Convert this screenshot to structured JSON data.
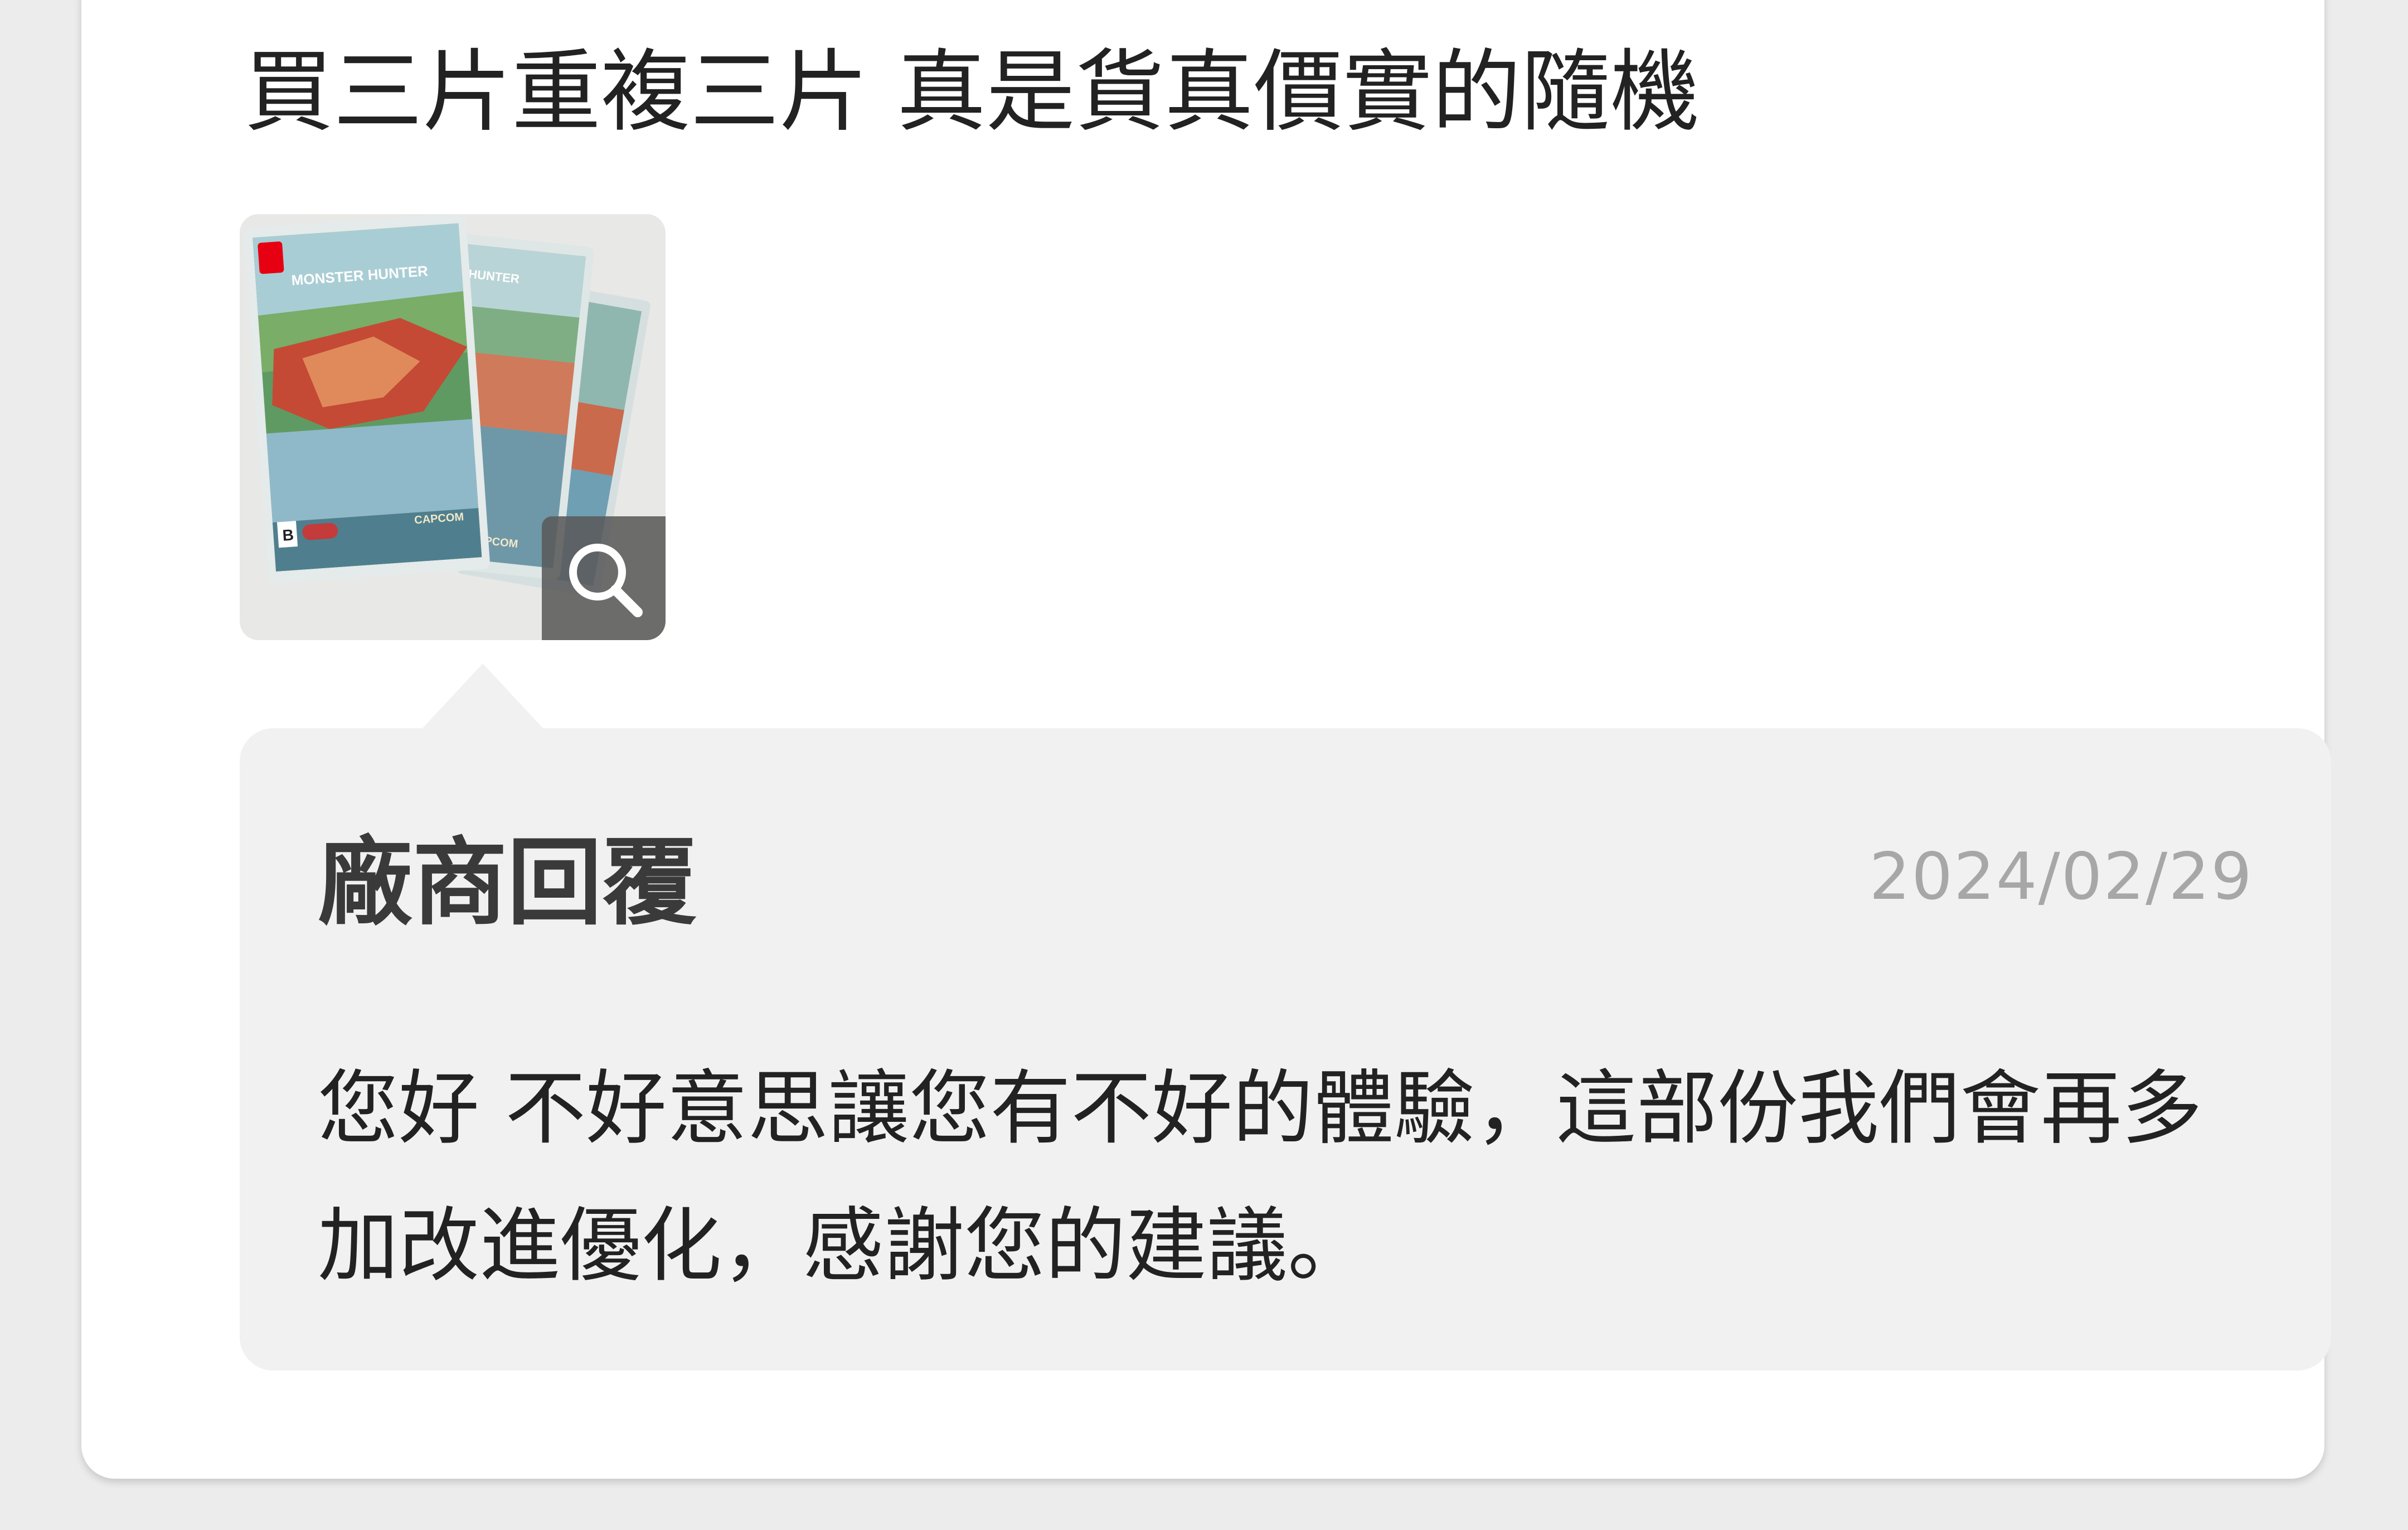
{
  "review": {
    "text": "買三片重複三片 真是貨真價實的隨機",
    "photo": {
      "label": "MONSTER HUNTER",
      "publisher": "CAPCOM",
      "rating_badge": "B",
      "zoom_icon": "magnifier-icon"
    }
  },
  "vendor_reply": {
    "title": "廠商回覆",
    "date": "2024/02/29",
    "body": "您好 不好意思讓您有不好的體驗，這部份我們會再多加改進優化，感謝您的建議。"
  },
  "colors": {
    "card_background": "#ffffff",
    "reply_background": "#f1f1f1",
    "text": "#222222",
    "date_text": "#a7a7a7",
    "zoom_overlay": "#5a5a5a"
  }
}
